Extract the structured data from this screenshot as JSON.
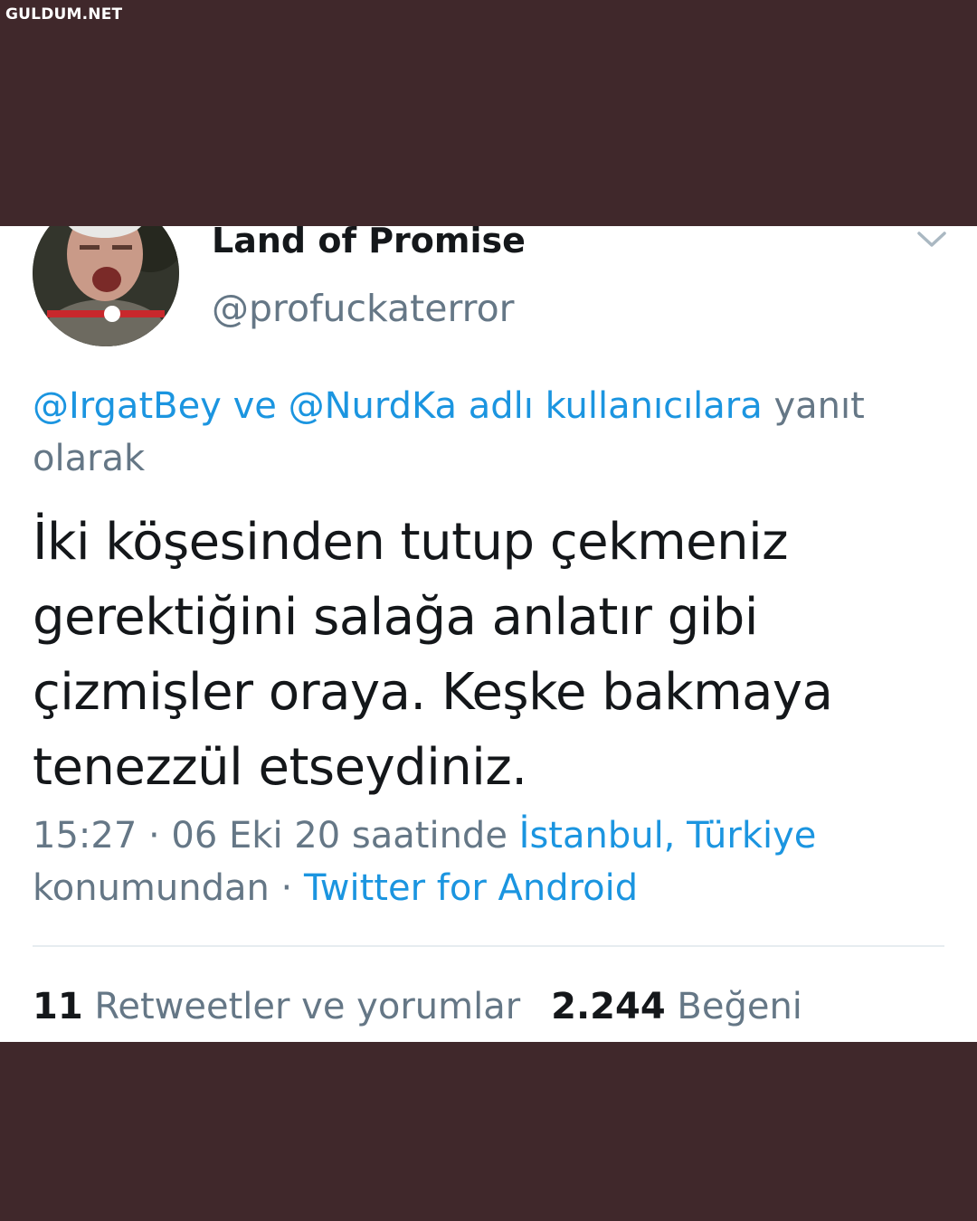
{
  "watermark": "GULDUM.NET",
  "tweet": {
    "display_name": "Land of Promise",
    "handle": "@profuckaterror",
    "reply": {
      "mention1": "@IrgatBey",
      "connector": " ve ",
      "mention2": "@NurdKa",
      "link_suffix": " adlı kullanıcılara",
      "suffix": " yanıt olarak"
    },
    "text_lines": [
      "İki köşesinden tutup çekmeniz",
      "gerektiğini salağa anlatır gibi",
      "çizmişler oraya. Keşke bakmaya",
      "tenezzül etseydiniz."
    ],
    "meta": {
      "time_date": "15:27 · 06 Eki 20 saatinde ",
      "location": "İstanbul, Türkiye",
      "location_suffix": " konumundan · ",
      "source": "Twitter for Android"
    },
    "stats": {
      "retweets_count": "11",
      "retweets_label": "Retweetler ve yorumlar",
      "likes_count": "2.244",
      "likes_label": "Beğeni"
    }
  },
  "icons": {
    "avatar": "profile-photo",
    "menu": "chevron-down-icon"
  },
  "colors": {
    "background": "#40282b",
    "card": "#ffffff",
    "link": "#1b95e0",
    "muted": "#657786",
    "text": "#14171a"
  }
}
